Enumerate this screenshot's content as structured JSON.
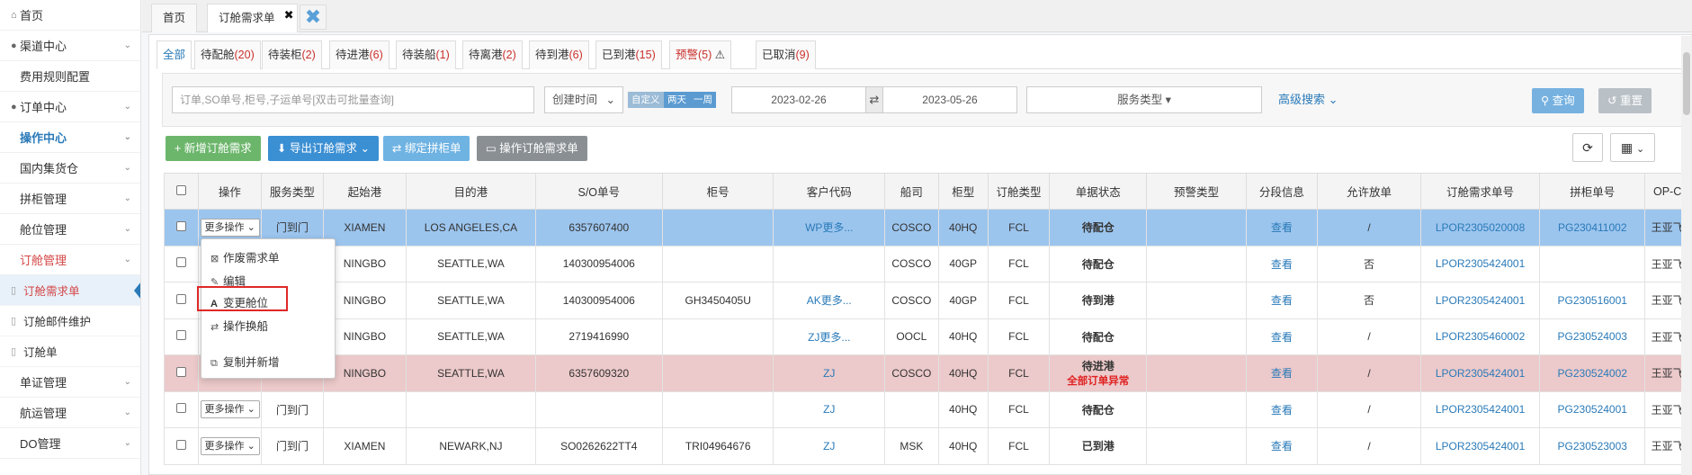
{
  "sidebar": {
    "items": [
      {
        "label": "首页",
        "lead": "⌂",
        "chev": ""
      },
      {
        "label": "渠道中心",
        "lead": "●",
        "chev": "⌄"
      },
      {
        "label": "费用规则配置",
        "lead": "",
        "chev": ""
      },
      {
        "label": "订单中心",
        "lead": "●",
        "chev": "⌄"
      },
      {
        "label": "操作中心",
        "lead": "",
        "chev": "⌄"
      },
      {
        "label": "国内集货仓",
        "lead": "",
        "chev": "⌄"
      },
      {
        "label": "拼柜管理",
        "lead": "",
        "chev": "⌄"
      },
      {
        "label": "舱位管理",
        "lead": "",
        "chev": "⌄"
      },
      {
        "label": "订舱管理",
        "lead": "",
        "chev": "⌄"
      }
    ],
    "subitems": [
      {
        "label": "订舱需求单"
      },
      {
        "label": "订舱邮件维护"
      },
      {
        "label": "订舱单"
      }
    ],
    "after": [
      {
        "label": "单证管理",
        "chev": "⌄"
      },
      {
        "label": "航运管理",
        "chev": "⌄"
      },
      {
        "label": "DO管理",
        "chev": "⌄"
      }
    ]
  },
  "topTabs": {
    "home": "首页",
    "current": "订舱需求单",
    "close_x": "✖",
    "close_all": "✖"
  },
  "statusTabs": [
    {
      "label": "全部",
      "count": ""
    },
    {
      "label": "待配舱",
      "count": "(20)"
    },
    {
      "label": "待装柜",
      "count": "(2)"
    },
    {
      "label": "待进港",
      "count": "(6)"
    },
    {
      "label": "待装船",
      "count": "(1)"
    },
    {
      "label": "待离港",
      "count": "(2)"
    },
    {
      "label": "待到港",
      "count": "(6)"
    },
    {
      "label": "已到港",
      "count": "(15)"
    },
    {
      "label": "预警",
      "count": "(5)",
      "warn": "⚠"
    },
    {
      "label": "已取消",
      "count": "(9)"
    }
  ],
  "filter": {
    "search_placeholder": "订单,SO单号,柜号,子运单号[双击可批量查询]",
    "date_field": "创建时间",
    "chips": [
      "自定义",
      "两天",
      "一周"
    ],
    "date_from": "2023-02-26",
    "date_to": "2023-05-26",
    "swap": "⇄",
    "service_type": "服务类型",
    "advanced": "高级搜索",
    "query_label": "查询",
    "reset_label": "重置"
  },
  "actions": {
    "add": "新增订舱需求",
    "export": "导出订舱需求",
    "bind": "绑定拼柜单",
    "operate": "操作订舱需求单"
  },
  "table": {
    "headers": [
      "",
      "操作",
      "服务类型",
      "起始港",
      "目的港",
      "S/O单号",
      "柜号",
      "客户代码",
      "船司",
      "柜型",
      "订舱类型",
      "单据状态",
      "预警类型",
      "分段信息",
      "允许放单",
      "订舱需求单号",
      "拼柜单号",
      "OP-C"
    ],
    "more_label": "更多操作",
    "view_label": "查看",
    "rows": [
      {
        "service": "门到门",
        "from": "XIAMEN",
        "to": "LOS ANGELES,CA",
        "so": "6357607400",
        "container": "",
        "customer": "WP更多...",
        "carrier": "COSCO",
        "ctype": "40HQ",
        "btype": "FCL",
        "status": "待配仓",
        "abnormal": "",
        "release": "/",
        "req_no": "LPOR2305020008",
        "consol_no": "PG230411002",
        "op": "王亚飞"
      },
      {
        "service": "",
        "from": "NINGBO",
        "to": "SEATTLE,WA",
        "so": "140300954006",
        "container": "",
        "customer": "",
        "carrier": "COSCO",
        "ctype": "40GP",
        "btype": "FCL",
        "status": "待配仓",
        "abnormal": "",
        "release": "否",
        "req_no": "LPOR2305424001",
        "consol_no": "",
        "op": "王亚飞"
      },
      {
        "service": "",
        "from": "NINGBO",
        "to": "SEATTLE,WA",
        "so": "140300954006",
        "container": "GH3450405U",
        "customer": "AK更多...",
        "carrier": "COSCO",
        "ctype": "40GP",
        "btype": "FCL",
        "status": "待到港",
        "abnormal": "",
        "release": "否",
        "req_no": "LPOR2305424001",
        "consol_no": "PG230516001",
        "op": "王亚飞"
      },
      {
        "service": "",
        "from": "NINGBO",
        "to": "SEATTLE,WA",
        "so": "2719416990",
        "container": "",
        "customer": "ZJ更多...",
        "carrier": "OOCL",
        "ctype": "40HQ",
        "btype": "FCL",
        "status": "待配仓",
        "abnormal": "",
        "release": "/",
        "req_no": "LPOR2305460002",
        "consol_no": "PG230524003",
        "op": "王亚飞"
      },
      {
        "service": "",
        "from": "NINGBO",
        "to": "SEATTLE,WA",
        "so": "6357609320",
        "container": "",
        "customer": "ZJ",
        "carrier": "COSCO",
        "ctype": "40HQ",
        "btype": "FCL",
        "status": "待进港",
        "abnormal": "全部订单异常",
        "release": "/",
        "req_no": "LPOR2305424001",
        "consol_no": "PG230524002",
        "op": "王亚飞"
      },
      {
        "service": "门到门",
        "from": "",
        "to": "",
        "so": "",
        "container": "",
        "customer": "ZJ",
        "carrier": "",
        "ctype": "40HQ",
        "btype": "FCL",
        "status": "待配仓",
        "abnormal": "",
        "release": "/",
        "req_no": "LPOR2305424001",
        "consol_no": "PG230524001",
        "op": "王亚飞"
      },
      {
        "service": "门到门",
        "from": "XIAMEN",
        "to": "NEWARK,NJ",
        "so": "SO0262622TT4",
        "container": "TRI04964676",
        "customer": "ZJ",
        "carrier": "MSK",
        "ctype": "40HQ",
        "btype": "FCL",
        "status": "已到港",
        "abnormal": "",
        "release": "/",
        "req_no": "LPOR2305424001",
        "consol_no": "PG230523003",
        "op": "王亚飞"
      }
    ]
  },
  "dropdown": {
    "items": [
      {
        "label": "作废需求单",
        "icon": "⊠"
      },
      {
        "label": "编辑",
        "icon": "✎"
      },
      {
        "label": "变更舱位",
        "icon": "A"
      },
      {
        "label": "操作换船",
        "icon": "⇄"
      },
      {
        "label": "复制并新增",
        "icon": "⧉"
      }
    ]
  },
  "colors": {
    "accent": "#2a7ab8",
    "selected_row": "#9cc5ee",
    "abnormal_row": "#ecc9ca",
    "highlight_border": "#e02828"
  }
}
